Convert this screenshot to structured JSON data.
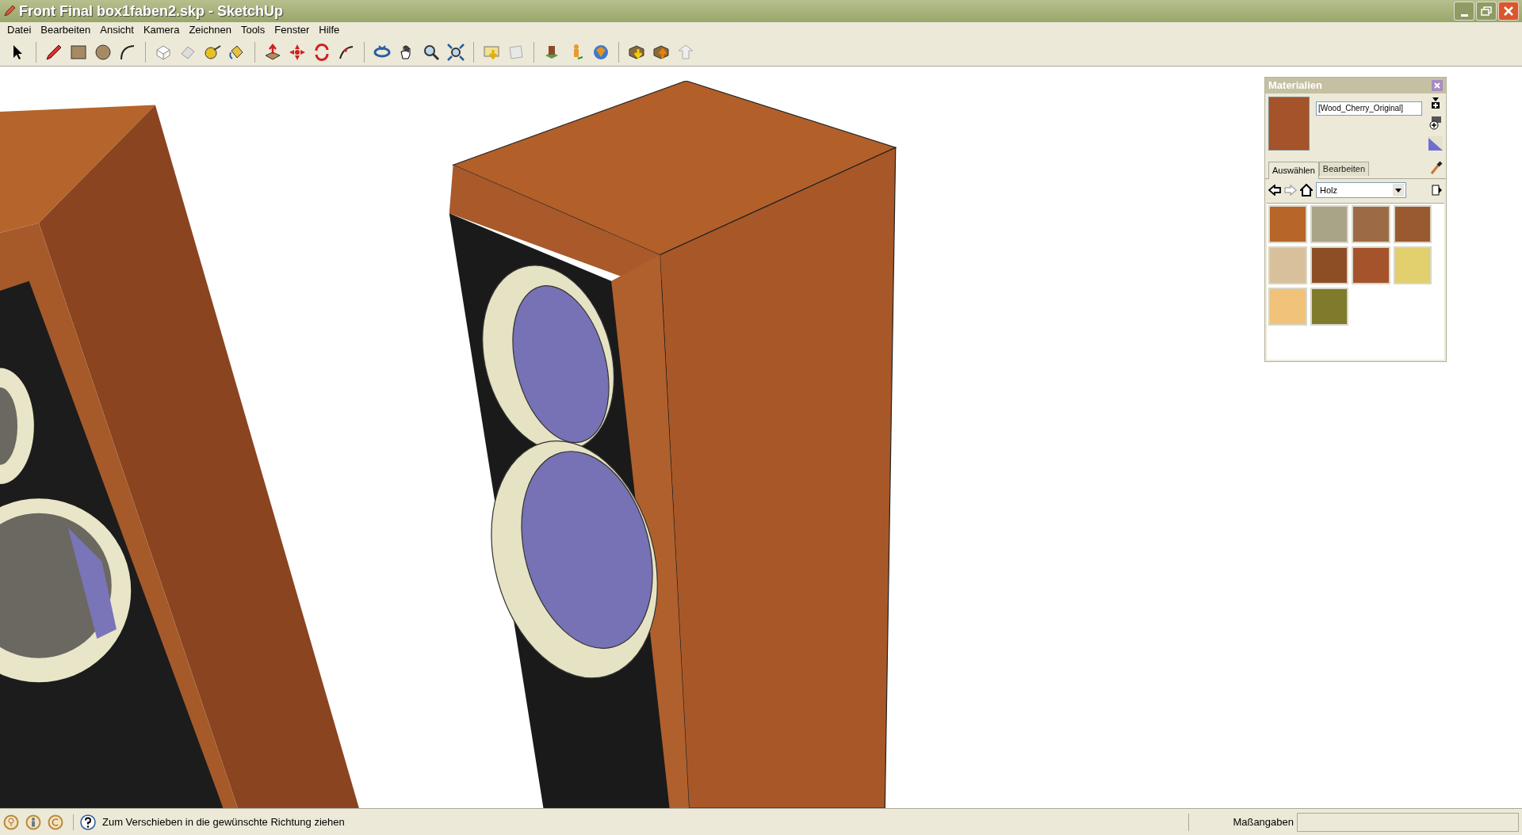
{
  "window": {
    "title": "Front Final box1faben2.skp - SketchUp"
  },
  "menu": [
    "Datei",
    "Bearbeiten",
    "Ansicht",
    "Kamera",
    "Zeichnen",
    "Tools",
    "Fenster",
    "Hilfe"
  ],
  "materials_panel": {
    "title": "Materialien",
    "material_name": "[Wood_Cherry_Original]",
    "tabs": [
      {
        "label": "Auswählen",
        "selected": true
      },
      {
        "label": "Bearbeiten",
        "selected": false
      }
    ],
    "collection": "Holz",
    "swatches": [
      {
        "color": "#b8652a"
      },
      {
        "color": "#a9a488"
      },
      {
        "color": "#9c6b45"
      },
      {
        "color": "#9a5a30"
      },
      {
        "color": "#d8c09a"
      },
      {
        "color": "#8e4e25"
      },
      {
        "color": "#a5532b"
      },
      {
        "color": "#e2cf6e"
      },
      {
        "color": "#f0c27a"
      },
      {
        "color": "#7f7a2c"
      }
    ]
  },
  "status_bar": {
    "message": "Zum Verschieben in die gewünschte Richtung ziehen",
    "measurements_label": "Maßangaben"
  }
}
